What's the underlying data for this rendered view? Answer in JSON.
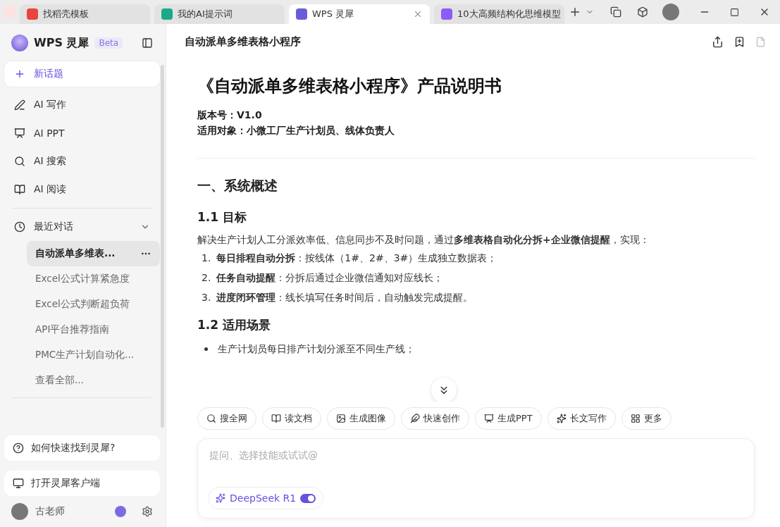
{
  "browser_tabs": [
    {
      "label": "找稻壳模板",
      "selected": false
    },
    {
      "label": "我的AI提示词",
      "selected": false
    },
    {
      "label": "WPS 灵犀",
      "selected": true
    },
    {
      "label": "10大高频结构化思维模型",
      "selected": false
    }
  ],
  "sidebar": {
    "brand": "WPS 灵犀",
    "badge": "Beta",
    "new_topic": "新话题",
    "nav": [
      {
        "label": "AI 写作"
      },
      {
        "label": "AI PPT"
      },
      {
        "label": "AI 搜索"
      },
      {
        "label": "AI 阅读"
      }
    ],
    "recent": {
      "label": "最近对话",
      "expanded": true,
      "items": [
        {
          "label": "自动派单多维表...",
          "selected": true
        },
        {
          "label": "Excel公式计算紧急度",
          "selected": false
        },
        {
          "label": "Excel公式判断超负荷",
          "selected": false
        },
        {
          "label": "API平台推荐指南",
          "selected": false
        },
        {
          "label": "PMC生产计划自动化...",
          "selected": false
        }
      ],
      "more": "查看全部..."
    },
    "help": "如何快速找到灵犀?",
    "open_client": "打开灵犀客户端",
    "user": "古老师"
  },
  "document": {
    "title": "自动派单多维表格小程序",
    "heading": "《自动派单多维表格小程序》产品说明书",
    "meta": [
      "版本号：V1.0",
      "适用对象：小微工厂生产计划员、线体负责人"
    ],
    "section": "一、系统概述",
    "sub1": "1.1 目标",
    "intro": "解决生产计划人工分派效率低、信息同步不及时问题，通过**多维表格自动化分拆+企业微信提醒**，实现：",
    "goals": [
      {
        "number": "1.",
        "text": "**每日排程自动分拆**：按线体（1#、2#、3#）生成独立数据表；"
      },
      {
        "number": "2.",
        "text": "**任务自动提醒**：分拆后通过企业微信通知对应线长；"
      },
      {
        "number": "3.",
        "text": "**进度闭环管理**：线长填写任务时间后，自动触发完成提醒。"
      }
    ],
    "sub2": "1.2 适用场景",
    "scenes": [
      "生产计划员每日排产计划分派至不同生产线；"
    ]
  },
  "skills": [
    "搜全网",
    "读文档",
    "生成图像",
    "快速创作",
    "生成PPT",
    "长文写作",
    "更多"
  ],
  "composer": {
    "placeholder": "提问、选择技能或试试@",
    "model": "DeepSeek R1",
    "model_on": true
  }
}
